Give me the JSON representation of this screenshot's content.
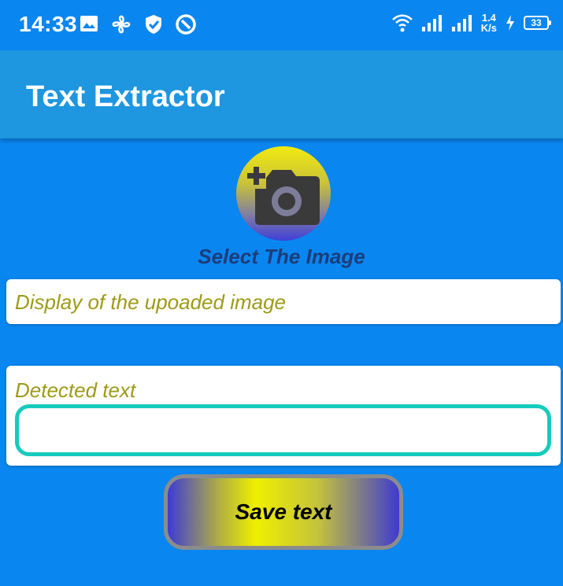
{
  "status_bar": {
    "time": "14:33",
    "left_icons": [
      "image-icon",
      "fan-icon",
      "shield-check-icon",
      "circle-slash-icon"
    ],
    "net_speed_value": "1.4",
    "net_speed_unit": "K/s",
    "battery_level": "33"
  },
  "app_bar": {
    "title": "Text Extractor",
    "color": "#1e96e0"
  },
  "picker": {
    "label": "Select The Image",
    "icon": "add-photo-camera-icon"
  },
  "image_display": {
    "placeholder": "Display of the upoaded image"
  },
  "detected_text": {
    "label": "Detected text",
    "value": ""
  },
  "save_button": {
    "label": "Save text"
  },
  "colors": {
    "background": "#0a86f0",
    "hint_text": "#9e9a18",
    "text_box_border": "#16cbbd"
  }
}
